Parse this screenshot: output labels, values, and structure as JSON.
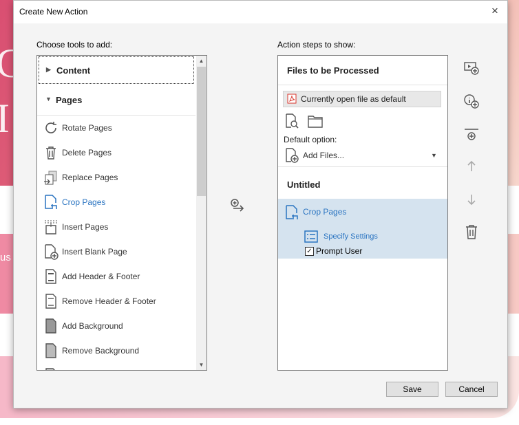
{
  "dialog": {
    "title": "Create New Action",
    "close_glyph": "×"
  },
  "left": {
    "heading": "Choose tools to add:",
    "sections": [
      {
        "label": "Content",
        "expanded": false
      },
      {
        "label": "Pages",
        "expanded": true
      }
    ],
    "tools": [
      {
        "label": "Rotate Pages",
        "icon": "rotate-pages-icon"
      },
      {
        "label": "Delete Pages",
        "icon": "trash-icon"
      },
      {
        "label": "Replace Pages",
        "icon": "replace-pages-icon"
      },
      {
        "label": "Crop Pages",
        "icon": "crop-pages-icon",
        "active": true
      },
      {
        "label": "Insert Pages",
        "icon": "insert-pages-icon"
      },
      {
        "label": "Insert Blank Page",
        "icon": "insert-blank-page-icon"
      },
      {
        "label": "Add Header & Footer",
        "icon": "header-footer-icon"
      },
      {
        "label": "Remove Header & Footer",
        "icon": "remove-header-footer-icon"
      },
      {
        "label": "Add Background",
        "icon": "add-background-icon"
      },
      {
        "label": "Remove Background",
        "icon": "remove-background-icon"
      }
    ]
  },
  "right": {
    "heading": "Action steps to show:",
    "files_title": "Files to be Processed",
    "default_file": "Currently open file as default",
    "default_option_label": "Default option:",
    "add_files": "Add Files...",
    "untitled": "Untitled",
    "step": {
      "label": "Crop Pages",
      "settings": "Specify Settings",
      "prompt_user": "Prompt User",
      "prompt_checked": true
    }
  },
  "buttons": {
    "save": "Save",
    "cancel": "Cancel"
  },
  "colors": {
    "accent_blue": "#2a74c1",
    "selected_step_bg": "#d5e3ef",
    "pdf_red": "#d9342b"
  },
  "background": {
    "partial_text": "us"
  }
}
